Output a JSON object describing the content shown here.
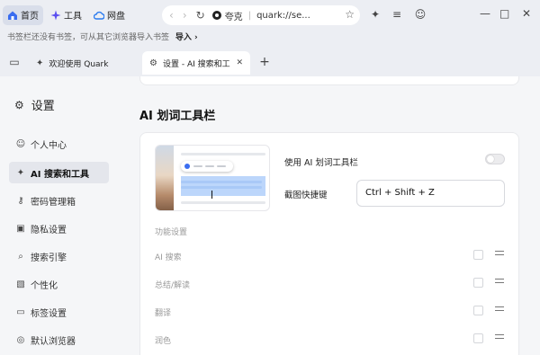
{
  "topbar": {
    "home_label": "首页",
    "tools_label": "工具",
    "drive_label": "网盘",
    "site_name": "夸克",
    "url": "quark://se..."
  },
  "bookmarks": {
    "message": "书签栏还没有书签，可从其它浏览器导入书签",
    "import_label": "导入"
  },
  "tabs": [
    {
      "label": "欢迎使用 Quark"
    },
    {
      "label": "设置 - AI 搜索和工具"
    }
  ],
  "sidebar": {
    "title": "设置",
    "items": [
      {
        "label": "个人中心",
        "icon": "person-icon"
      },
      {
        "label": "AI 搜索和工具",
        "icon": "sparkle-icon"
      },
      {
        "label": "密码管理箱",
        "icon": "key-icon"
      },
      {
        "label": "隐私设置",
        "icon": "lock-icon"
      },
      {
        "label": "搜索引擎",
        "icon": "search-icon"
      },
      {
        "label": "个性化",
        "icon": "personalize-icon"
      },
      {
        "label": "标签设置",
        "icon": "tab-icon"
      },
      {
        "label": "默认浏览器",
        "icon": "compass-icon"
      }
    ]
  },
  "main": {
    "section_title": "AI 划词工具栏",
    "toolbar_toggle_label": "使用 AI 划词工具栏",
    "toolbar_enabled": false,
    "shortcut_label": "截图快捷键",
    "shortcut_value": "Ctrl + Shift + Z",
    "functions_label": "功能设置",
    "functions": [
      {
        "label": "AI 搜索"
      },
      {
        "label": "总结/解读"
      },
      {
        "label": "翻译"
      },
      {
        "label": "润色"
      }
    ]
  },
  "colors": {
    "highlight": "#bcd6fb",
    "accent": "#3a6df0"
  }
}
